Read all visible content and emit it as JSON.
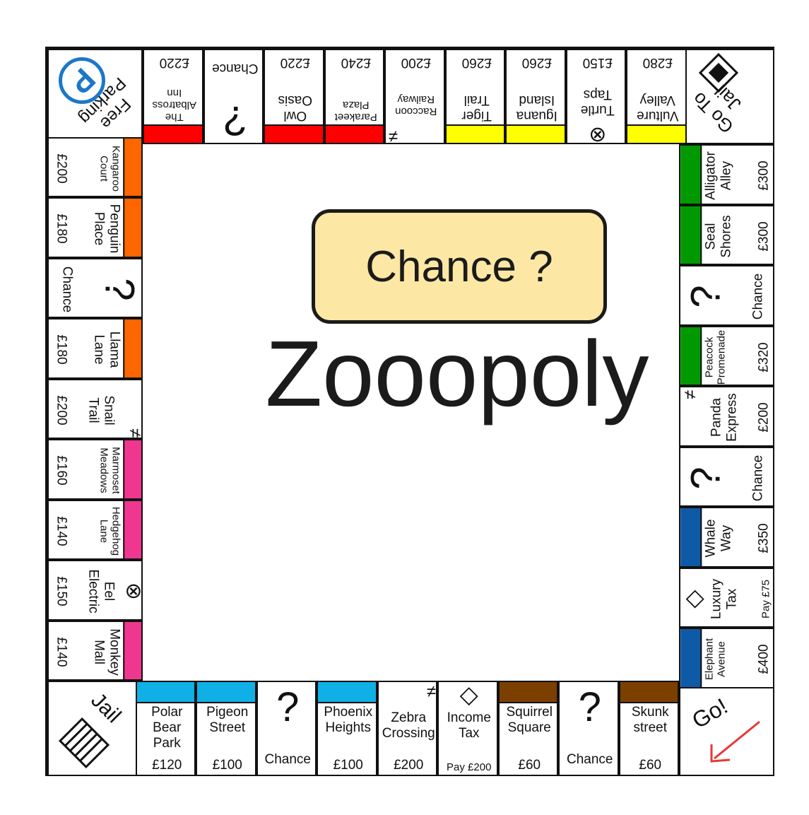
{
  "board": {
    "title": "Zooopoly",
    "chance_card": "Chance ?",
    "colors": {
      "light_blue": "#0fb0e6",
      "brown": "#7b3f00",
      "pink": "#f0378f",
      "orange": "#ff6600",
      "red": "#ff0000",
      "yellow": "#ffff00",
      "green": "#009900",
      "dark_blue": "#0e5aa7",
      "card": "#fce8a4"
    },
    "corners": {
      "go": {
        "label": "Go!",
        "icon": "red-arrow-icon"
      },
      "jail": {
        "label": "Jail",
        "icon": "jail-bars-icon"
      },
      "free_parking": {
        "label": "Free\nParking",
        "icon": "parking-icon",
        "icon_text": "P"
      },
      "go_to_jail": {
        "label": "Go To\nJail",
        "icon": "diamond-icon"
      }
    },
    "bottom": [
      {
        "type": "property",
        "name": "Skunk\nstreet",
        "price": "£60",
        "color": "brown"
      },
      {
        "type": "chance",
        "label": "Chance"
      },
      {
        "type": "property",
        "name": "Squirrel\nSquare",
        "price": "£60",
        "color": "brown"
      },
      {
        "type": "tax",
        "name": "Income\nTax",
        "price": "Pay £200"
      },
      {
        "type": "rail",
        "name": "Zebra\nCrossing",
        "price": "£200"
      },
      {
        "type": "property",
        "name": "Phoenix\nHeights",
        "price": "£100",
        "color": "light_blue"
      },
      {
        "type": "chance",
        "label": "Chance"
      },
      {
        "type": "property",
        "name": "Pigeon\nStreet",
        "price": "£100",
        "color": "light_blue"
      },
      {
        "type": "property",
        "name": "Polar\nBear\nPark",
        "price": "£120",
        "color": "light_blue"
      }
    ],
    "left": [
      {
        "type": "property",
        "name": "Monkey\nMall",
        "price": "£140",
        "color": "pink"
      },
      {
        "type": "utility",
        "name": "Eel\nElectric",
        "price": "£150"
      },
      {
        "type": "property",
        "name": "Hedgehog\nLane",
        "price": "£140",
        "color": "pink",
        "small": true
      },
      {
        "type": "property",
        "name": "Marmoset\nMeadows",
        "price": "£160",
        "color": "pink",
        "small": true
      },
      {
        "type": "rail",
        "name": "Snail\nTrail",
        "price": "£200"
      },
      {
        "type": "property",
        "name": "Llama\nLane",
        "price": "£180",
        "color": "orange"
      },
      {
        "type": "chance",
        "label": "Chance"
      },
      {
        "type": "property",
        "name": "Penguin\nPlace",
        "price": "£180",
        "color": "orange"
      },
      {
        "type": "property",
        "name": "Kangaroo\nCourt",
        "price": "£200",
        "color": "orange",
        "small": true
      }
    ],
    "top": [
      {
        "type": "property",
        "name": "The\nAlbatross\nInn",
        "price": "£220",
        "color": "red",
        "small": true
      },
      {
        "type": "chance",
        "label": "Chance"
      },
      {
        "type": "property",
        "name": "Owl\nOasis",
        "price": "£220",
        "color": "red"
      },
      {
        "type": "property",
        "name": "Parakeet\nPlaza",
        "price": "£240",
        "color": "red",
        "small": true
      },
      {
        "type": "rail",
        "name": "Raccoon\nRailway",
        "price": "£200",
        "small": true
      },
      {
        "type": "property",
        "name": "Tiger\nTrail",
        "price": "£260",
        "color": "yellow"
      },
      {
        "type": "property",
        "name": "Iguana\nIsland",
        "price": "£260",
        "color": "yellow"
      },
      {
        "type": "utility",
        "name": "Turtle\nTaps",
        "price": "£150"
      },
      {
        "type": "property",
        "name": "Vulture\nValley",
        "price": "£280",
        "color": "yellow"
      }
    ],
    "right": [
      {
        "type": "property",
        "name": "Alligator\nAlley",
        "price": "£300",
        "color": "green"
      },
      {
        "type": "property",
        "name": "Seal\nShores",
        "price": "£300",
        "color": "green"
      },
      {
        "type": "chance",
        "label": "Chance"
      },
      {
        "type": "property",
        "name": "Peacock\nPromenade",
        "price": "£320",
        "color": "green",
        "small": true
      },
      {
        "type": "rail",
        "name": "Panda\nExpress",
        "price": "£200"
      },
      {
        "type": "chance",
        "label": "Chance"
      },
      {
        "type": "property",
        "name": "Whale\nWay",
        "price": "£350",
        "color": "dark_blue"
      },
      {
        "type": "tax",
        "name": "Luxury\nTax",
        "price": "Pay £75"
      },
      {
        "type": "property",
        "name": "Elephant\nAvenue",
        "price": "£400",
        "color": "dark_blue",
        "small": true
      }
    ]
  }
}
